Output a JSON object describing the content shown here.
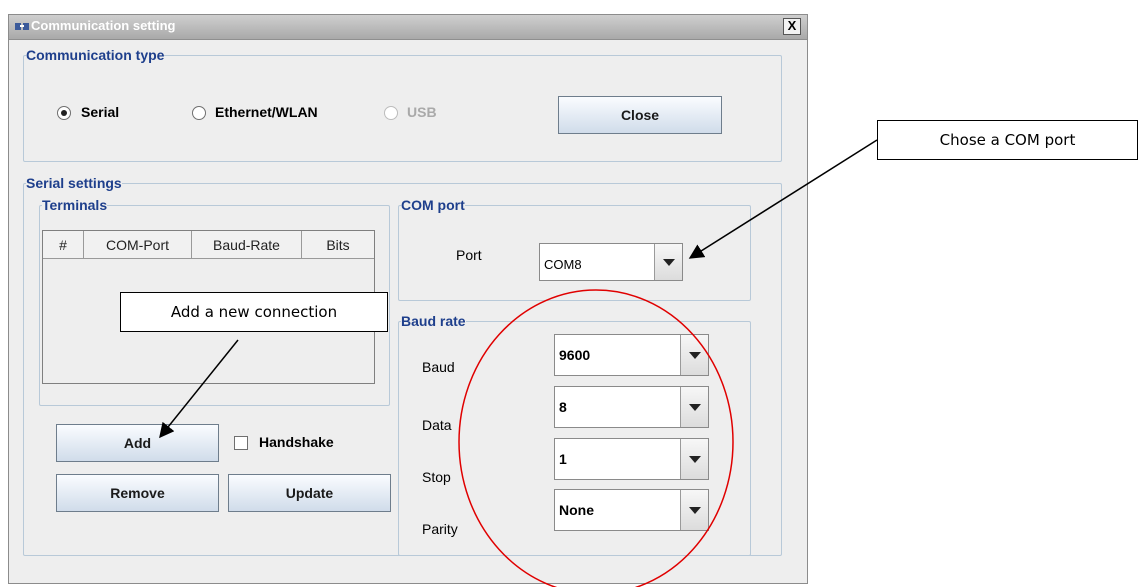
{
  "window": {
    "title": "Communication setting",
    "close_glyph": "X",
    "icon": "app-icon"
  },
  "communication_type": {
    "legend": "Communication type",
    "options": [
      {
        "label": "Serial",
        "selected": true,
        "enabled": true
      },
      {
        "label": "Ethernet/WLAN",
        "selected": false,
        "enabled": true
      },
      {
        "label": "USB",
        "selected": false,
        "enabled": false
      }
    ],
    "close_button": "Close"
  },
  "serial_settings": {
    "legend": "Serial settings",
    "terminals": {
      "legend": "Terminals",
      "columns": [
        "#",
        "COM-Port",
        "Baud-Rate",
        "Bits"
      ],
      "rows": []
    },
    "com_port": {
      "legend": "COM port",
      "label": "Port",
      "value": "COM8"
    },
    "baud_rate": {
      "legend": "Baud rate",
      "fields": [
        {
          "label": "Baud",
          "value": "9600"
        },
        {
          "label": "Data",
          "value": "8"
        },
        {
          "label": "Stop",
          "value": "1"
        },
        {
          "label": "Parity",
          "value": "None"
        }
      ]
    },
    "buttons": {
      "add": "Add",
      "remove": "Remove",
      "update": "Update"
    },
    "handshake": {
      "label": "Handshake",
      "checked": false
    }
  },
  "annotations": {
    "com_port_note": "Chose a COM port",
    "add_note": "Add a new connection",
    "highlight_color": "#e00000"
  }
}
